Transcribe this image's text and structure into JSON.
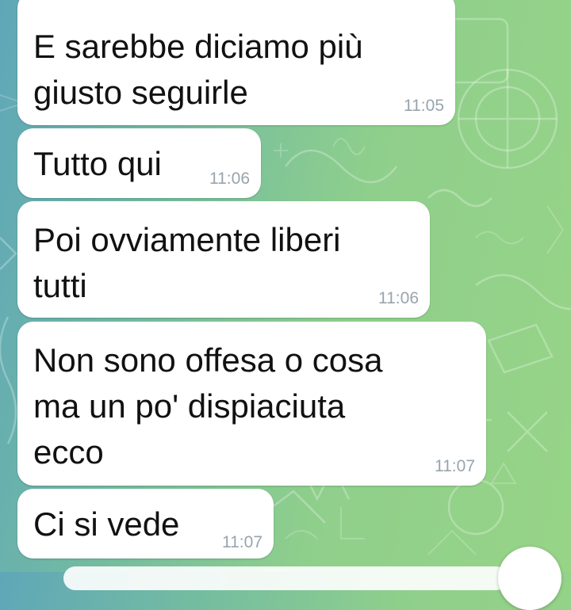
{
  "chat": {
    "messages": [
      {
        "text": "E sarebbe diciamo più\ngiusto seguirle",
        "time": "11:05"
      },
      {
        "text": "Tutto qui",
        "time": "11:06"
      },
      {
        "text": "Poi ovviamente liberi\ntutti",
        "time": "11:06"
      },
      {
        "text": "Non sono offesa o cosa\nma un po' dispiaciuta\necco",
        "time": "11:07"
      },
      {
        "text": "Ci si vede",
        "time": "11:07"
      }
    ]
  },
  "theme": {
    "bubble_color": "#ffffff",
    "text_color": "#111111",
    "time_color": "#98a4ad",
    "wallpaper_from": "#5fa7b8",
    "wallpaper_to": "#97d487",
    "wallpaper_pattern": "math-doodles"
  },
  "icons": {
    "scroll_button": "scroll-down-icon"
  }
}
